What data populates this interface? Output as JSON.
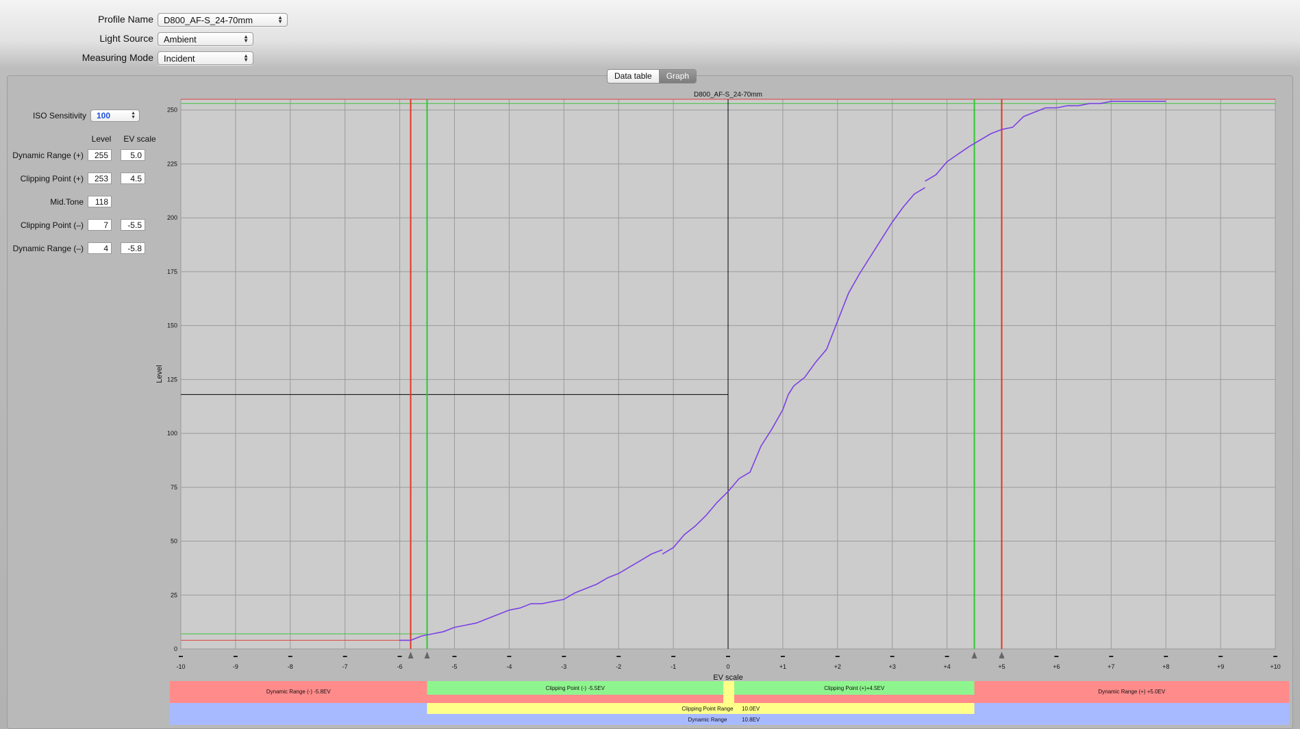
{
  "header": {
    "profile_name_label": "Profile Name",
    "profile_name_value": "D800_AF-S_24-70mm",
    "light_source_label": "Light Source",
    "light_source_value": "Ambient",
    "measuring_mode_label": "Measuring Mode",
    "measuring_mode_value": "Incident"
  },
  "tabs": {
    "data_table": "Data table",
    "graph": "Graph",
    "selected": "Graph"
  },
  "side": {
    "iso_label": "ISO Sensitivity",
    "iso_value": "100",
    "col_level": "Level",
    "col_ev": "EV scale",
    "rows": [
      {
        "label": "Dynamic Range (+)",
        "level": "255",
        "ev": "5.0"
      },
      {
        "label": "Clipping Point (+)",
        "level": "253",
        "ev": "4.5"
      },
      {
        "label": "Mid.Tone",
        "level": "118",
        "ev": ""
      },
      {
        "label": "Clipping Point (–)",
        "level": "7",
        "ev": "-5.5"
      },
      {
        "label": "Dynamic Range (–)",
        "level": "4",
        "ev": "-5.8"
      }
    ]
  },
  "chart_data": {
    "type": "line",
    "title": "D800_AF-S_24-70mm",
    "xlabel": "EV scale",
    "ylabel": "Level",
    "xlim": [
      -10,
      10
    ],
    "ylim": [
      0,
      255
    ],
    "x_ticks": [
      "-10",
      "-9",
      "-8",
      "-7",
      "-6",
      "-5",
      "-4",
      "-3",
      "-2",
      "-1",
      "0",
      "+1",
      "+2",
      "+3",
      "+4",
      "+5",
      "+6",
      "+7",
      "+8",
      "+9",
      "+10"
    ],
    "y_ticks": [
      0,
      25,
      50,
      75,
      100,
      125,
      150,
      175,
      200,
      225,
      250
    ],
    "grid": true,
    "series": [
      {
        "color": "#7b3fe4",
        "points": [
          [
            -6,
            4
          ],
          [
            -5.8,
            4
          ],
          [
            -5.6,
            6
          ],
          [
            -5.4,
            7
          ],
          [
            -5.2,
            8
          ],
          [
            -5,
            10
          ],
          [
            -4.8,
            11
          ],
          [
            -4.6,
            12
          ],
          [
            -4.4,
            14
          ],
          [
            -4.2,
            16
          ],
          [
            -4,
            18
          ],
          [
            -3.8,
            19
          ],
          [
            -3.6,
            21
          ],
          [
            -3.4,
            21
          ],
          [
            -3.2,
            22
          ],
          [
            -3,
            23
          ],
          [
            -2.8,
            26
          ],
          [
            -2.6,
            28
          ],
          [
            -2.4,
            30
          ],
          [
            -2.2,
            33
          ],
          [
            -2,
            35
          ],
          [
            -1.8,
            38
          ],
          [
            -1.6,
            41
          ],
          [
            -1.4,
            44
          ],
          [
            -1.2,
            46
          ]
        ]
      },
      {
        "color": "#7b3fe4",
        "points": [
          [
            -1.2,
            44
          ],
          [
            -1,
            47
          ],
          [
            -0.8,
            53
          ],
          [
            -0.6,
            57
          ],
          [
            -0.4,
            62
          ],
          [
            -0.2,
            68
          ],
          [
            0,
            73
          ],
          [
            0.2,
            79
          ],
          [
            0.4,
            82
          ],
          [
            0.6,
            94
          ],
          [
            0.8,
            102
          ],
          [
            1,
            111
          ],
          [
            1.1,
            118
          ],
          [
            1.2,
            122
          ],
          [
            1.4,
            126
          ],
          [
            1.6,
            133
          ],
          [
            1.8,
            139
          ],
          [
            2,
            152
          ],
          [
            2.2,
            165
          ],
          [
            2.4,
            174
          ],
          [
            2.6,
            182
          ],
          [
            2.8,
            190
          ],
          [
            3,
            198
          ],
          [
            3.2,
            205
          ],
          [
            3.4,
            211
          ],
          [
            3.6,
            214
          ]
        ]
      },
      {
        "color": "#7b3fe4",
        "points": [
          [
            3.6,
            217
          ],
          [
            3.8,
            220
          ],
          [
            4,
            226
          ],
          [
            4.4,
            233
          ],
          [
            4.8,
            239
          ],
          [
            5,
            241
          ],
          [
            5.2,
            242
          ],
          [
            5.4,
            247
          ],
          [
            5.6,
            249
          ],
          [
            5.8,
            251
          ],
          [
            6,
            251
          ],
          [
            6.2,
            252
          ],
          [
            6.4,
            252
          ],
          [
            6.6,
            253
          ],
          [
            6.8,
            253
          ],
          [
            7,
            254
          ],
          [
            8,
            254
          ]
        ]
      }
    ],
    "markers": {
      "dynamic_range_minus_ev": -5.8,
      "clipping_minus_ev": -5.5,
      "midtone_level": 118,
      "clipping_plus_ev": 4.5,
      "dynamic_range_plus_ev": 5.0,
      "clipping_plus_level": 253,
      "dynamic_range_plus_level": 255,
      "clipping_minus_level": 7,
      "dynamic_range_minus_level": 4
    },
    "ranges": {
      "dr_minus_label": "Dynamic Range (-) -5.8EV",
      "cp_minus_label": "Clipping Point (-) -5.5EV",
      "cp_plus_label": "Clipping Point (+)+4.5EV",
      "dr_plus_label": "Dynamic Range (+) +5.0EV",
      "cp_range_label": "Clipping Point Range",
      "cp_range_value": "10.0EV",
      "dr_label": "Dynamic Range",
      "dr_value": "10.8EV"
    },
    "colors": {
      "red": "#ff8b8b",
      "green": "#8ef58e",
      "yellow": "#ffff8a",
      "blue": "#a8baff",
      "plot_bg": "#cccccc"
    }
  }
}
